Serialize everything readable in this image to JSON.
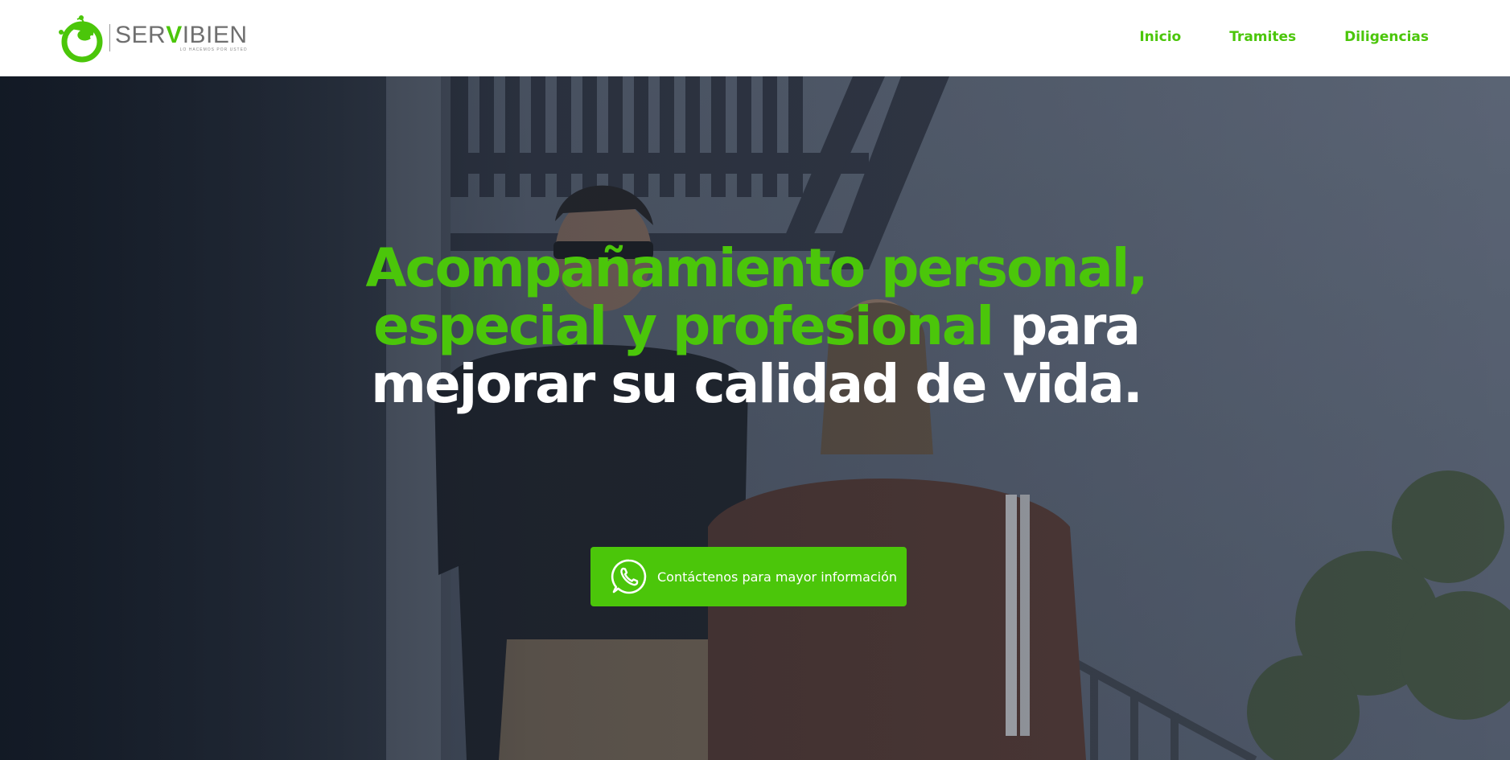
{
  "brand": {
    "name_prefix": "SER",
    "name_accent": "V",
    "name_suffix": "IBIEN",
    "tagline": "LO HACEMOS POR USTED",
    "logo_icon": "gecko-logo-icon",
    "accent_color": "#4bc60a",
    "text_color": "#6f6f6f"
  },
  "nav": {
    "items": [
      {
        "label": "Inicio"
      },
      {
        "label": "Tramites"
      },
      {
        "label": "Diligencias"
      }
    ]
  },
  "hero": {
    "headline_green": "Acompañamiento personal, especial y profesional",
    "headline_white": "para mejorar su calidad de vida.",
    "cta_label": "Contáctenos para mayor información",
    "cta_icon": "whatsapp-icon",
    "overlay_color": "#4a5568"
  }
}
